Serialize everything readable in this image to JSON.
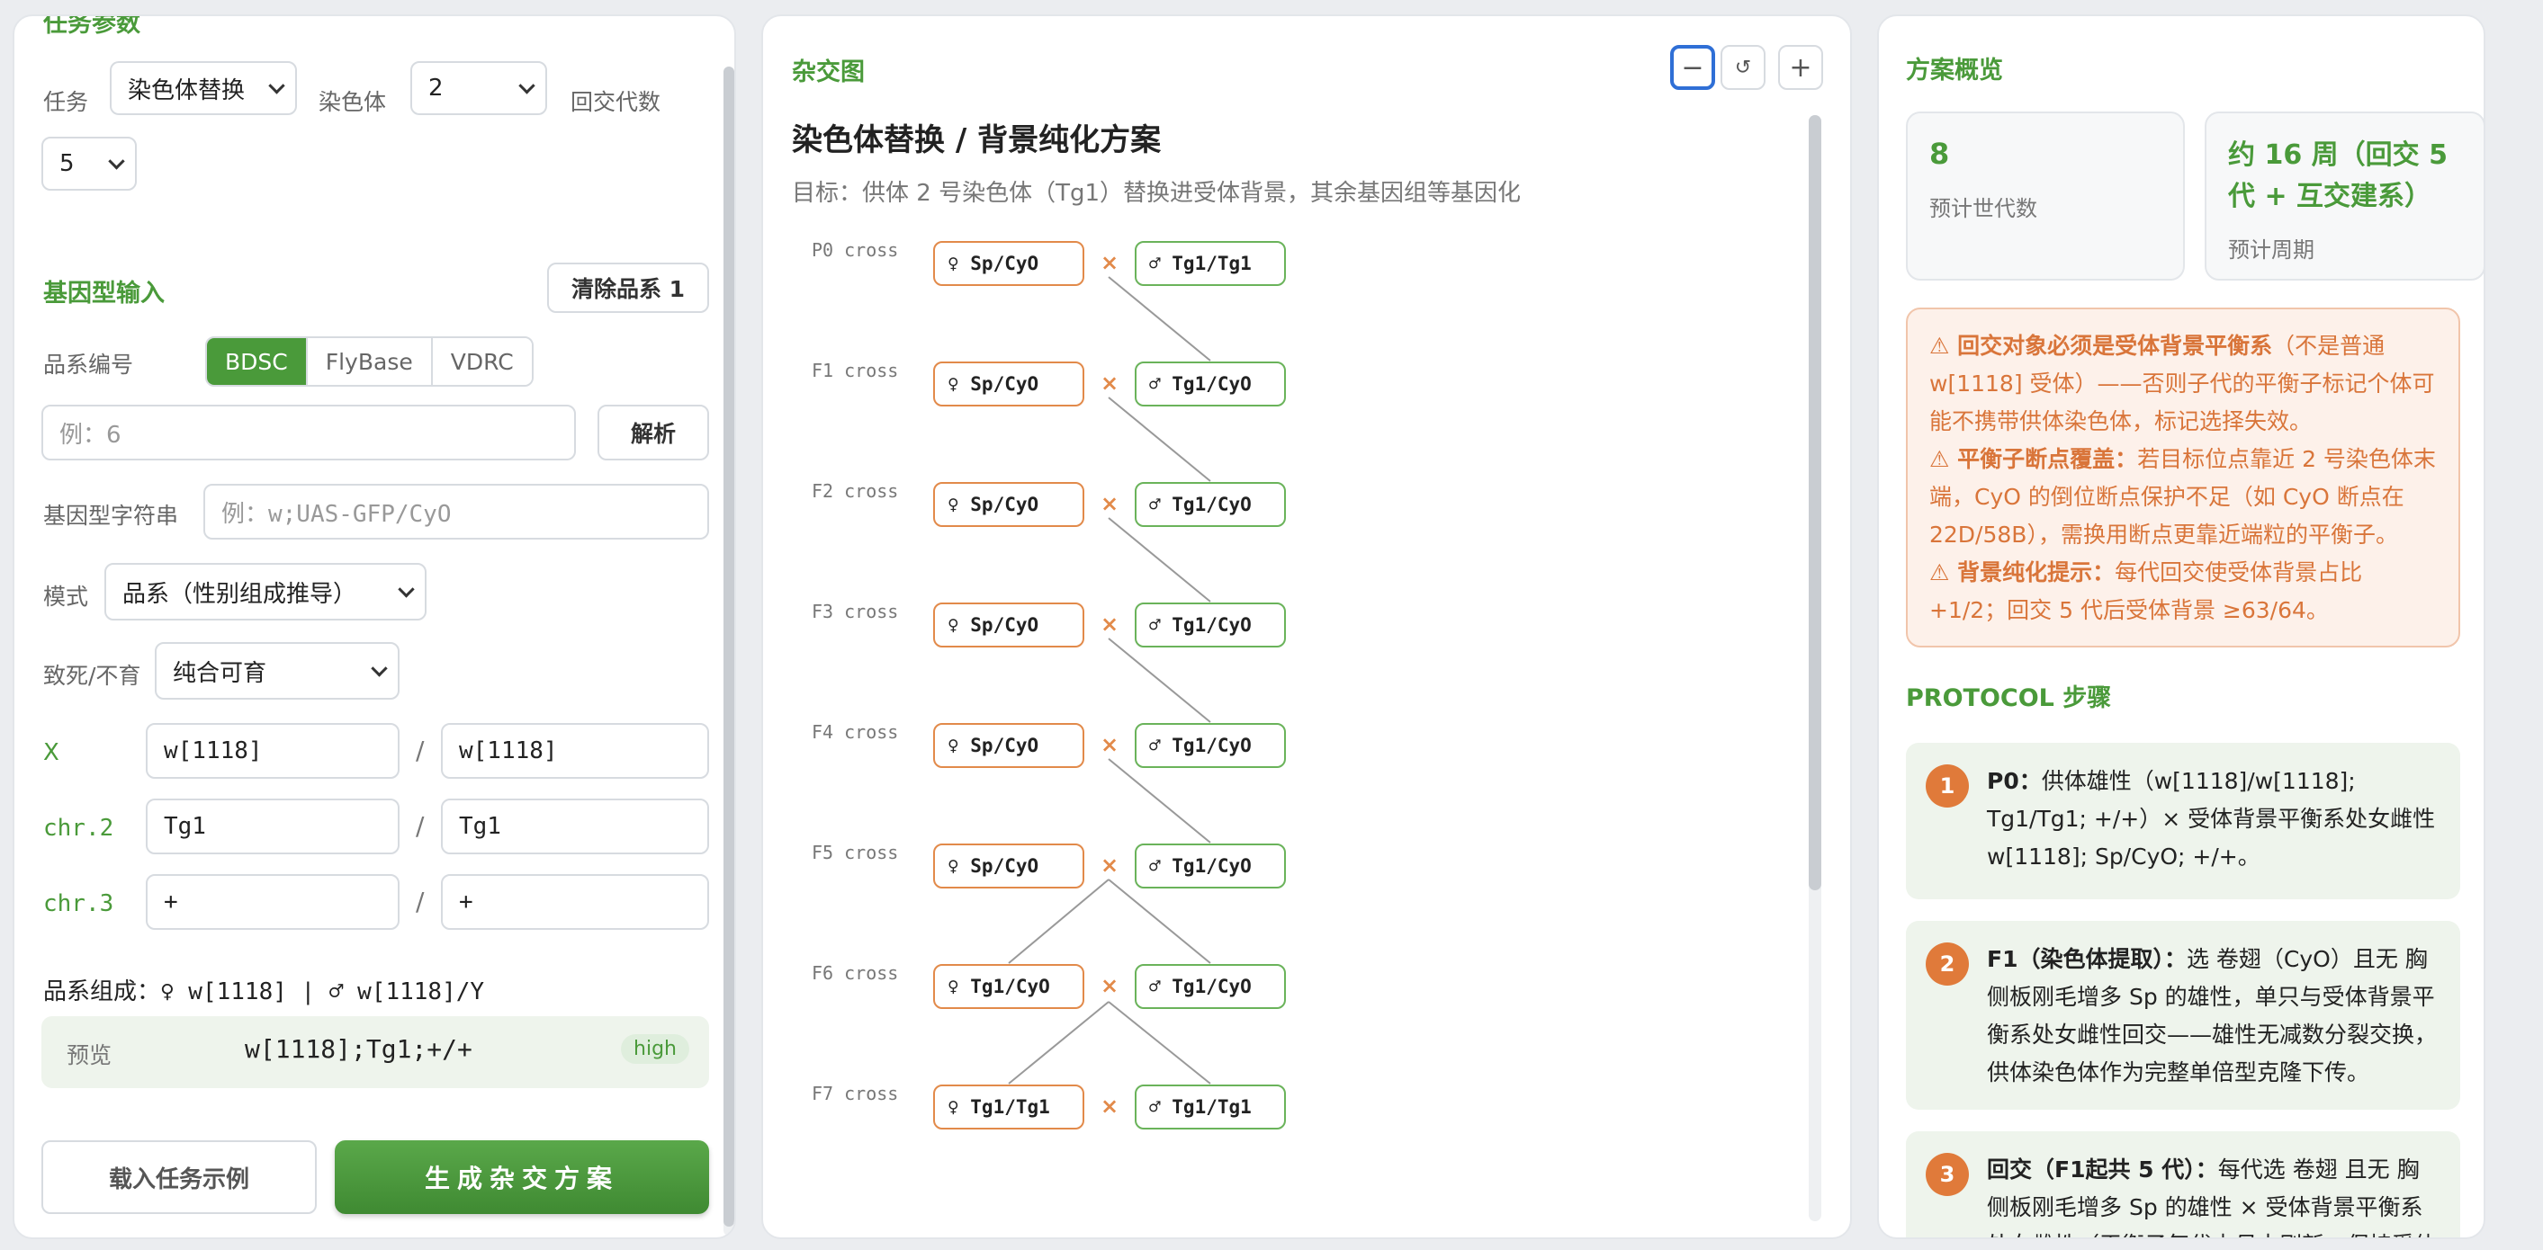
{
  "left": {
    "cut_title": "任务参数",
    "task_label": "任务",
    "task_value": "染色体替换",
    "chromosome_label": "染色体",
    "chromosome_value": "2",
    "backcross_label": "回交代数",
    "backcross_value": "5",
    "genotype_title": "基因型输入",
    "clear_button": "清除品系 1",
    "stock_label": "品系编号",
    "db_tabs": [
      "BDSC",
      "FlyBase",
      "VDRC"
    ],
    "stock_placeholder": "例：6",
    "parse_button": "解析",
    "genostring_label": "基因型字符串",
    "genostring_placeholder": "例：w;UAS-GFP/CyO",
    "mode_label": "模式",
    "mode_value": "品系（性别组成推导）",
    "lethal_label": "致死/不育",
    "lethal_value": "纯合可育",
    "chr_rows": [
      {
        "label": "X",
        "a": "w[1118]",
        "b": "w[1118]"
      },
      {
        "label": "chr.2",
        "a": "Tg1",
        "b": "Tg1"
      },
      {
        "label": "chr.3",
        "a": "+",
        "b": "+"
      }
    ],
    "composition": "品系组成：♀ w[1118] | ♂ w[1118]/Y",
    "preview_label": "预览",
    "preview_value": "w[1118];Tg1;+/+",
    "preview_badge": "high",
    "load_button": "载入任务示例",
    "generate_button": "生成杂交方案"
  },
  "middle": {
    "title": "杂交图",
    "zoom_out": "−",
    "zoom_reset": "↺",
    "zoom_in": "+",
    "plan_title": "染色体替换 / 背景纯化方案",
    "plan_goal": "目标：供体 2 号染色体（Tg1）替换进受体背景，其余基因组等基因化",
    "crosses": [
      {
        "gen": "P0 cross",
        "female": "♀ Sp/CyO",
        "male": "♂ Tg1/Tg1"
      },
      {
        "gen": "F1 cross",
        "female": "♀ Sp/CyO",
        "male": "♂ Tg1/CyO"
      },
      {
        "gen": "F2 cross",
        "female": "♀ Sp/CyO",
        "male": "♂ Tg1/CyO"
      },
      {
        "gen": "F3 cross",
        "female": "♀ Sp/CyO",
        "male": "♂ Tg1/CyO"
      },
      {
        "gen": "F4 cross",
        "female": "♀ Sp/CyO",
        "male": "♂ Tg1/CyO"
      },
      {
        "gen": "F5 cross",
        "female": "♀ Sp/CyO",
        "male": "♂ Tg1/CyO"
      },
      {
        "gen": "F6 cross",
        "female": "♀ Tg1/CyO",
        "male": "♂ Tg1/CyO"
      },
      {
        "gen": "F7 cross",
        "female": "♀ Tg1/Tg1",
        "male": "♂ Tg1/Tg1"
      }
    ],
    "cross_symbol": "×"
  },
  "right": {
    "title": "方案概览",
    "gen_count": "8",
    "gen_count_label": "预计世代数",
    "period_value": "约 16 周（回交 5 代 + 互交建系）",
    "period_label": "预计周期",
    "warnings": [
      {
        "head": "⚠ 回交对象必须是受体背景平衡系",
        "body": "（不是普通 w[1118] 受体）——否则子代的平衡子标记个体可能不携带供体染色体，标记选择失效。"
      },
      {
        "head": "⚠ 平衡子断点覆盖：",
        "body": "若目标位点靠近 2 号染色体末端，CyO 的倒位断点保护不足（如 CyO 断点在 22D/58B），需换用断点更靠近端粒的平衡子。"
      },
      {
        "head": "⚠ 背景纯化提示：",
        "body": "每代回交使受体背景占比 +1/2；回交 5 代后受体背景 ≥63/64。"
      }
    ],
    "protocol_title": "PROTOCOL 步骤",
    "steps": [
      {
        "num": "1",
        "head": "P0：",
        "body": "供体雄性（w[1118]/w[1118]; Tg1/Tg1; +/+）× 受体背景平衡系处女雌性 w[1118]; Sp/CyO; +/+。"
      },
      {
        "num": "2",
        "head": "F1（染色体提取）：",
        "body": "选 卷翅（CyO）且无 胸侧板刚毛增多 Sp 的雄性，单只与受体背景平衡系处女雌性回交——雄性无减数分裂交换，供体染色体作为完整单倍型克隆下传。"
      },
      {
        "num": "3",
        "head": "回交（F1起共 5 代）：",
        "body": "每代选 卷翅 且无 胸侧板刚毛增多 Sp 的雄性 × 受体背景平衡系处女雌性（平衡子每代由母本刷新，保持受体"
      }
    ]
  }
}
